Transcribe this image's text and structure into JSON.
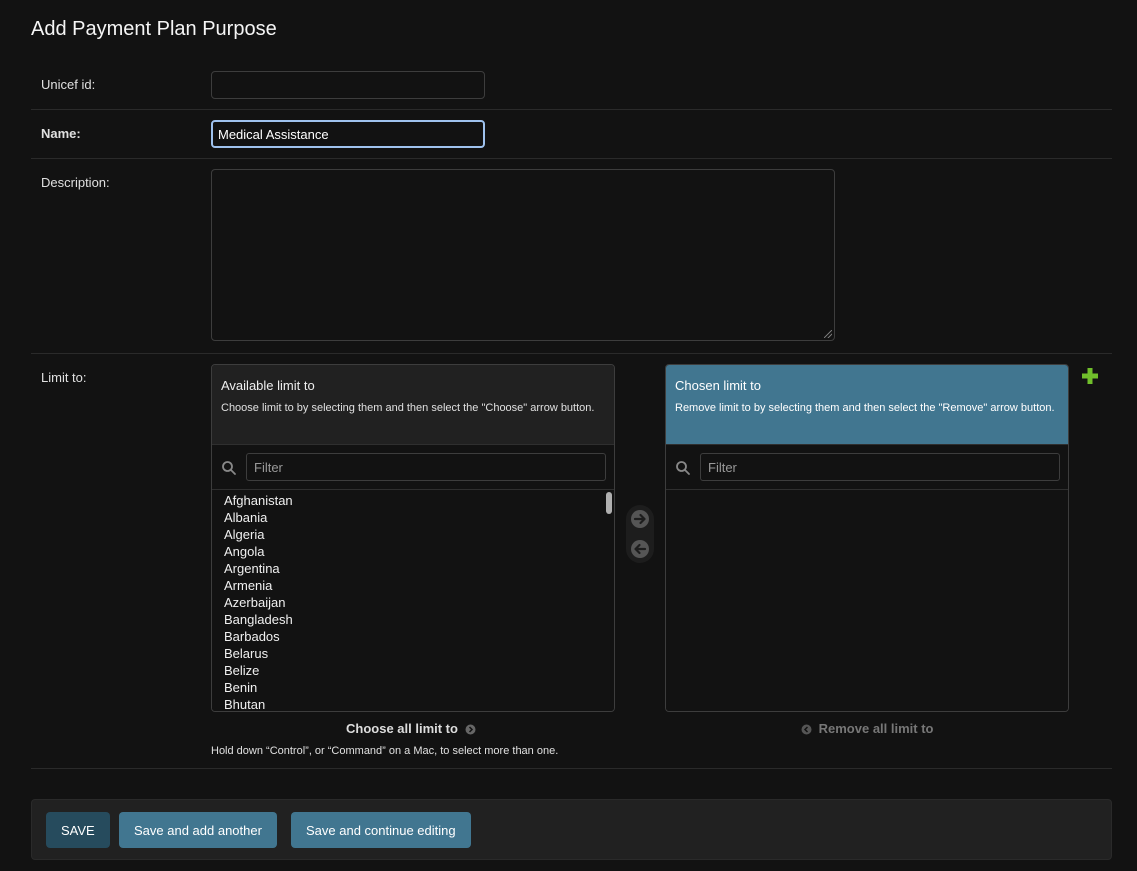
{
  "page": {
    "title": "Add Payment Plan Purpose"
  },
  "fields": {
    "unicef_id": {
      "label": "Unicef id:",
      "value": ""
    },
    "name": {
      "label": "Name:",
      "value": "Medical Assistance"
    },
    "description": {
      "label": "Description:",
      "value": ""
    },
    "limit_to": {
      "label": "Limit to:"
    }
  },
  "available": {
    "title": "Available limit to",
    "help": "Choose limit to by selecting them and then select the \"Choose\" arrow button.",
    "filter_placeholder": "Filter",
    "options": [
      "Afghanistan",
      "Albania",
      "Algeria",
      "Angola",
      "Argentina",
      "Armenia",
      "Azerbaijan",
      "Bangladesh",
      "Barbados",
      "Belarus",
      "Belize",
      "Benin",
      "Bhutan"
    ],
    "choose_all": "Choose all limit to"
  },
  "chosen": {
    "title": "Chosen limit to",
    "help": "Remove limit to by selecting them and then select the \"Remove\" arrow button.",
    "filter_placeholder": "Filter",
    "options": [],
    "remove_all": "Remove all limit to"
  },
  "help_text": "Hold down “Control”, or “Command” on a Mac, to select more than one.",
  "buttons": {
    "save": "SAVE",
    "save_add_another": "Save and add another",
    "save_continue": "Save and continue editing"
  },
  "colors": {
    "background": "#121212",
    "header_chosen": "#417690",
    "primary_button": "#264b5d",
    "add_plus": "#70bf2b"
  }
}
